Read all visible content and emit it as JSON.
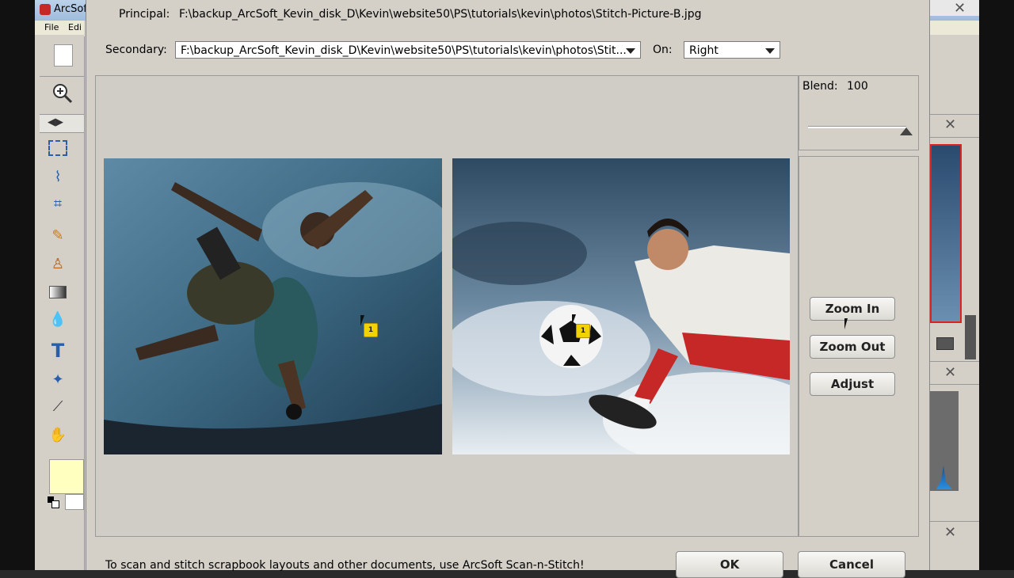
{
  "background_app": {
    "title": "ArcSof",
    "menu": [
      "File",
      "Edi"
    ]
  },
  "dialog": {
    "principal_label": "Principal:",
    "principal_path": "F:\\backup_ArcSoft_Kevin_disk_D\\Kevin\\website50\\PS\\tutorials\\kevin\\photos\\Stitch-Picture-B.jpg",
    "secondary_label": "Secondary:",
    "secondary_value": "F:\\backup_ArcSoft_Kevin_disk_D\\Kevin\\website50\\PS\\tutorials\\kevin\\photos\\Stit...",
    "on_label": "On:",
    "on_value": "Right",
    "blend_label": "Blend:",
    "blend_value": "100",
    "blend_level": 1.0,
    "zoom_in": "Zoom In",
    "zoom_out": "Zoom Out",
    "adjust": "Adjust",
    "marker_left": "1",
    "marker_right": "1",
    "footer_text": "To scan and stitch scrapbook layouts and other documents, use ArcSoft Scan-n-Stitch!",
    "ok": "OK",
    "cancel": "Cancel"
  },
  "colors": {
    "dialog_bg": "#d4d0c8",
    "fg_swatch": "#ffffc0",
    "marker": "#f2d200"
  }
}
